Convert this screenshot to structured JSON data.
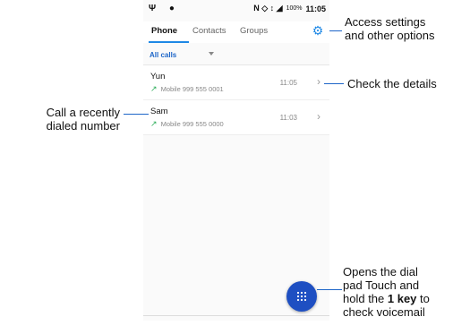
{
  "status_bar": {
    "left_icons": "Ψ ●",
    "right_icons": "N ◇ ↕ ◢",
    "battery": "100%",
    "time": "11:05"
  },
  "tabs": [
    {
      "label": "Phone"
    },
    {
      "label": "Contacts"
    },
    {
      "label": "Groups"
    }
  ],
  "filter": {
    "label": "All calls"
  },
  "calls": [
    {
      "name": "Yun",
      "type": "Mobile",
      "number": "999 555 0001",
      "time": "11:05"
    },
    {
      "name": "Sam",
      "type": "Mobile",
      "number": "999 555 0000",
      "time": "11:03"
    }
  ],
  "annotations": {
    "settings_1": "Access settings",
    "settings_2": "and other options",
    "details": "Check the details",
    "recent_1": "Call  a  recently",
    "recent_2": "dialed  number",
    "dial_1": "Opens the dial",
    "dial_2": "pad Touch and",
    "dial_3_prefix": "hold the ",
    "dial_3_bold": "1 key",
    "dial_3_suffix": " to",
    "dial_4": "check voicemail"
  },
  "colors": {
    "accent": "#1e88e5",
    "fab": "#1e4fc2",
    "call_arrow": "#2eae5a"
  },
  "icons": {
    "settings": "gear-icon",
    "dialpad": "dialpad-icon",
    "details": "chevron-right-icon",
    "outgoing": "outgoing-call-icon"
  }
}
